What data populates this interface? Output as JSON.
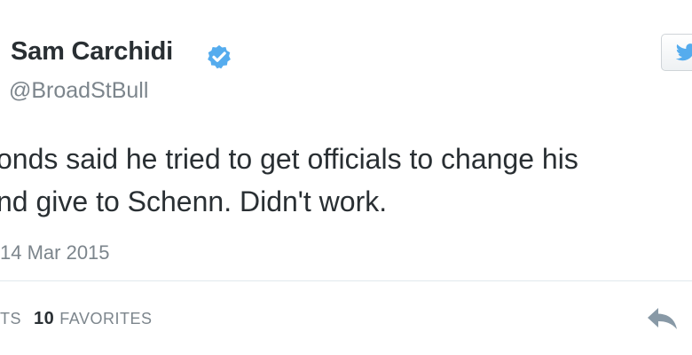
{
  "author": {
    "name": "Sam Carchidi",
    "handle": "@BroadStBull",
    "verified": true,
    "verified_icon": "verified-badge-icon",
    "verified_color": "#55acee"
  },
  "follow_button": {
    "icon": "twitter-bird-icon",
    "icon_color": "#55acee"
  },
  "tweet": {
    "line1": "onds said he tried to get officials to change his",
    "line2": "nd give to Schenn. Didn't work."
  },
  "timestamp": "14 Mar 2015",
  "stats": {
    "retweets_label": "TS",
    "favorites_count": "10",
    "favorites_label": "FAVORITES"
  },
  "actions": {
    "reply_icon": "reply-icon"
  }
}
